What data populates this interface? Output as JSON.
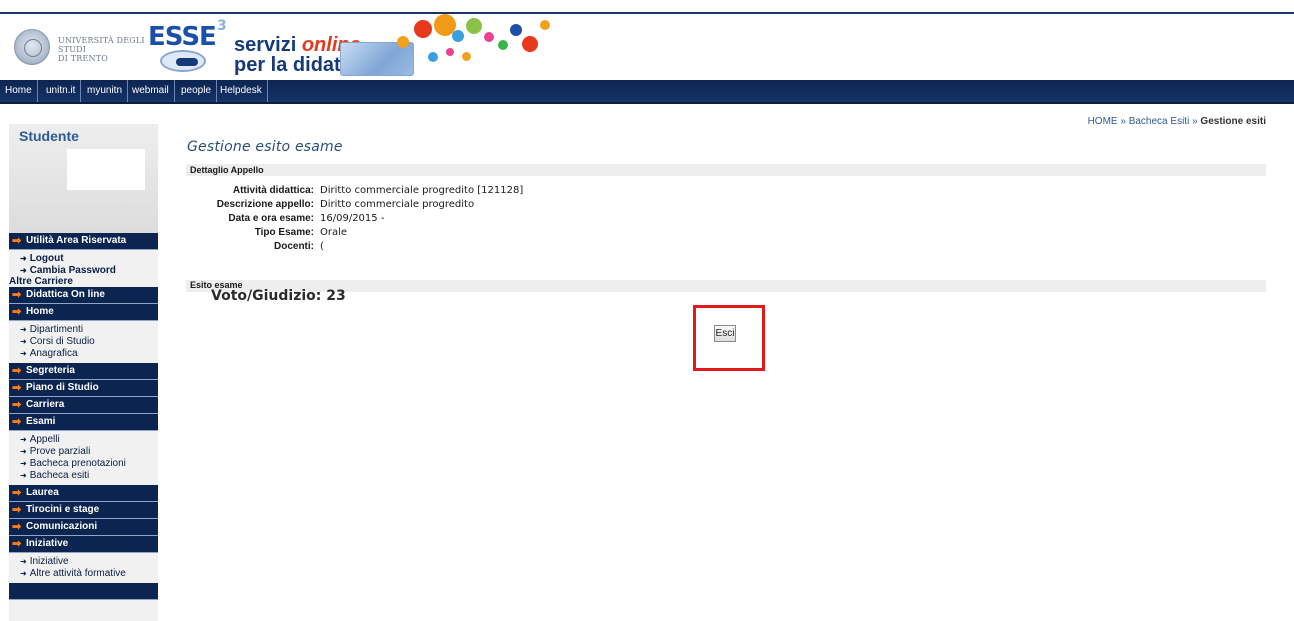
{
  "header": {
    "university_name_line1": "UNIVERSITÀ DEGLI STUDI",
    "university_name_line2": "DI TRENTO",
    "esse_logo": "ESSE",
    "esse_superscript": "3",
    "servizi": "servizi",
    "online": "online",
    "per_la_didattica": "per la didattica"
  },
  "navbar": {
    "items": [
      "Home",
      "unitn.it",
      "myunitn",
      "webmail",
      "people",
      "Helpdesk"
    ]
  },
  "sidebar": {
    "title": "Studente",
    "sections": [
      {
        "label": "Utilità Area Riservata"
      },
      {
        "label": "Didattica On line"
      },
      {
        "label": "Home"
      },
      {
        "label": "Segreteria"
      },
      {
        "label": "Piano di Studio"
      },
      {
        "label": "Carriera"
      },
      {
        "label": "Esami"
      },
      {
        "label": "Laurea"
      },
      {
        "label": "Tirocini e stage"
      },
      {
        "label": "Comunicazioni"
      },
      {
        "label": "Iniziative"
      }
    ],
    "utilita_items": [
      "Logout",
      "Cambia Password"
    ],
    "altre_carriere": "Altre Carriere",
    "home_items": [
      "Dipartimenti",
      "Corsi di Studio",
      "Anagrafica"
    ],
    "esami_items": [
      "Appelli",
      "Prove parziali",
      "Bacheca prenotazioni",
      "Bacheca esiti"
    ],
    "iniziative_items": [
      "Iniziative",
      "Altre attività formative"
    ]
  },
  "breadcrumb": {
    "home": "HOME",
    "separator": "»",
    "bacheca": "Bacheca Esiti",
    "current": "Gestione esiti"
  },
  "main": {
    "title": "Gestione esito esame",
    "dettaglio_section": "Dettaglio Appello",
    "details": [
      {
        "label": "Attività didattica:",
        "value": "Diritto commerciale progredito [121128]"
      },
      {
        "label": "Descrizione appello:",
        "value": "Diritto commerciale progredito"
      },
      {
        "label": "Data e ora esame:",
        "value": "16/09/2015 -"
      },
      {
        "label": "Tipo Esame:",
        "value": "Orale"
      },
      {
        "label": "Docenti:",
        "value": "("
      }
    ],
    "esito_section": "Esito esame",
    "voto": "Voto/Giudizio: 23",
    "esci_label": "Esci"
  },
  "colors": {
    "nav_bg": "#0c2551",
    "accent_orange": "#ff7b16",
    "highlight_red": "#e11a1a",
    "title_blue": "#2a4f7a"
  }
}
